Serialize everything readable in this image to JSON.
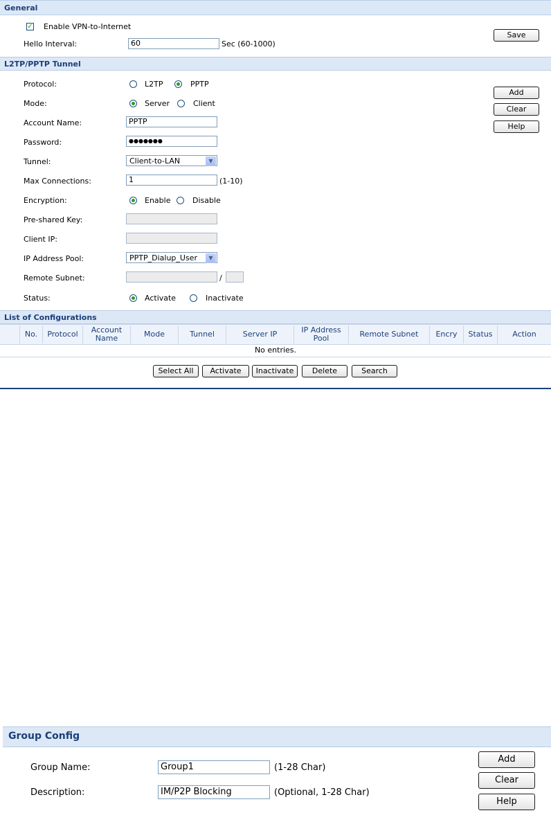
{
  "general": {
    "title": "General",
    "enable_vpn_label": "Enable VPN-to-Internet",
    "enable_vpn_checked": true,
    "hello_interval_label": "Hello Interval:",
    "hello_interval_value": "60",
    "hello_interval_hint": "Sec (60-1000)",
    "save_label": "Save"
  },
  "tunnel": {
    "title": "L2TP/PPTP Tunnel",
    "protocol_label": "Protocol:",
    "protocol_options": [
      "L2TP",
      "PPTP"
    ],
    "protocol_selected": "PPTP",
    "mode_label": "Mode:",
    "mode_options": [
      "Server",
      "Client"
    ],
    "mode_selected": "Server",
    "account_label": "Account Name:",
    "account_value": "PPTP",
    "password_label": "Password:",
    "password_value": "●●●●●●●",
    "tunnel_label": "Tunnel:",
    "tunnel_value": "Client-to-LAN",
    "max_conn_label": "Max Connections:",
    "max_conn_value": "1",
    "max_conn_hint": "(1-10)",
    "encryption_label": "Encryption:",
    "encryption_options": [
      "Enable",
      "Disable"
    ],
    "encryption_selected": "Enable",
    "psk_label": "Pre-shared Key:",
    "client_ip_label": "Client IP:",
    "pool_label": "IP Address Pool:",
    "pool_value": "PPTP_Dialup_User",
    "remote_subnet_label": "Remote Subnet:",
    "subnet_sep": "/",
    "status_label": "Status:",
    "status_options": [
      "Activate",
      "Inactivate"
    ],
    "status_selected": "Activate",
    "add_label": "Add",
    "clear_label": "Clear",
    "help_label": "Help"
  },
  "list": {
    "title": "List of Configurations",
    "columns": [
      "",
      "No.",
      "Protocol",
      "Account Name",
      "Mode",
      "Tunnel",
      "Server IP",
      "IP Address Pool",
      "Remote Subnet",
      "Encry",
      "Status",
      "Action"
    ],
    "empty_text": "No entries.",
    "buttons": [
      "Select All",
      "Activate",
      "Inactivate",
      "Delete",
      "Search"
    ]
  },
  "group": {
    "title": "Group Config",
    "name_label": "Group Name:",
    "name_value": "Group1",
    "name_hint": "(1-28 Char)",
    "desc_label": "Description:",
    "desc_value": "IM/P2P Blocking",
    "desc_hint": "(Optional, 1-28 Char)",
    "add_label": "Add",
    "clear_label": "Clear",
    "help_label": "Help"
  },
  "colors": {
    "section_bg": "#dde8f6",
    "section_title": "#1a3f7a",
    "radio_dot": "#21a121"
  }
}
